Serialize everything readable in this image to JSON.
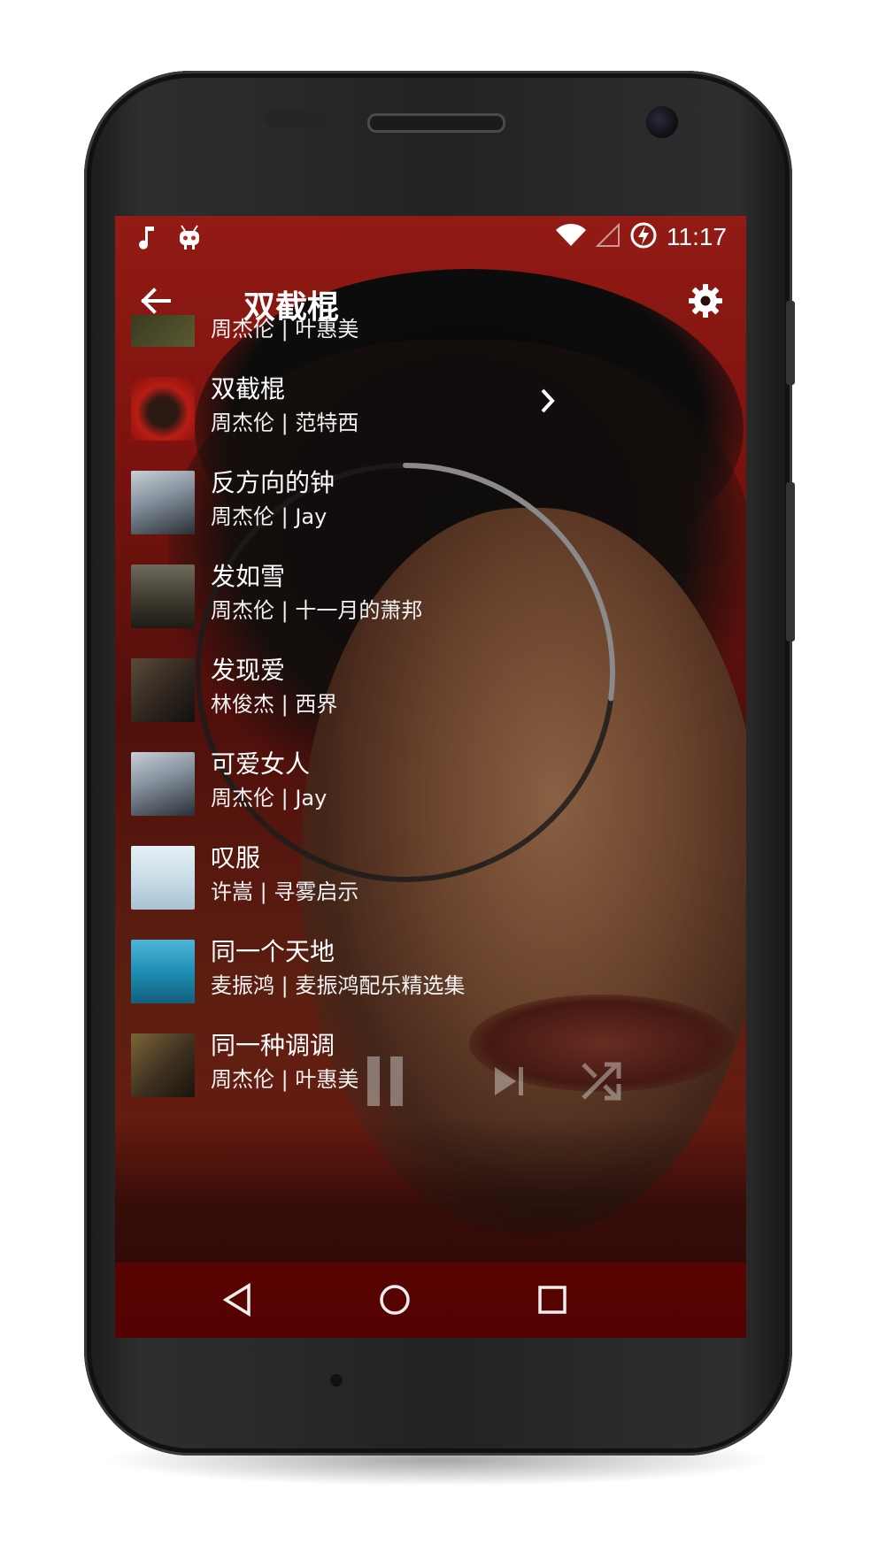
{
  "status_bar": {
    "time": "11:17",
    "left_icons": [
      "music-note-icon",
      "cyanogen-icon"
    ],
    "right_icons": [
      "wifi-icon",
      "signal-icon",
      "battery-charging-icon"
    ]
  },
  "toolbar": {
    "title": "双截棍",
    "back_icon": "arrow-left-icon",
    "settings_icon": "gear-icon"
  },
  "songs": [
    {
      "title": "",
      "subtitle": "周杰伦 | 叶惠美",
      "thumb_color": "#3a3a22"
    },
    {
      "title": "双截棍",
      "subtitle": "周杰伦 | 范特西",
      "thumb_color": "#b01a14",
      "expanded": true
    },
    {
      "title": "反方向的钟",
      "subtitle": "周杰伦 | Jay",
      "thumb_color": "#6c7885"
    },
    {
      "title": "发如雪",
      "subtitle": "周杰伦 | 十一月的萧邦",
      "thumb_color": "#4a4538"
    },
    {
      "title": "发现爱",
      "subtitle": "林俊杰 | 西界",
      "thumb_color": "#3b3027"
    },
    {
      "title": "可爱女人",
      "subtitle": "周杰伦 | Jay",
      "thumb_color": "#6c7885"
    },
    {
      "title": "叹服",
      "subtitle": "许嵩 | 寻雾启示",
      "thumb_color": "#cfe1ea"
    },
    {
      "title": "同一个天地",
      "subtitle": "麦振鸿 | 麦振鸿配乐精选集",
      "thumb_color": "#1e8fb3"
    },
    {
      "title": "同一种调调",
      "subtitle": "周杰伦 | 叶惠美",
      "thumb_color": "#5b4a2a"
    }
  ],
  "player": {
    "progress": 0.27,
    "controls": [
      "pause-icon",
      "skip-next-icon",
      "shuffle-icon"
    ]
  },
  "nav_bar": {
    "buttons": [
      "back-triangle-icon",
      "home-circle-icon",
      "recents-square-icon"
    ]
  }
}
